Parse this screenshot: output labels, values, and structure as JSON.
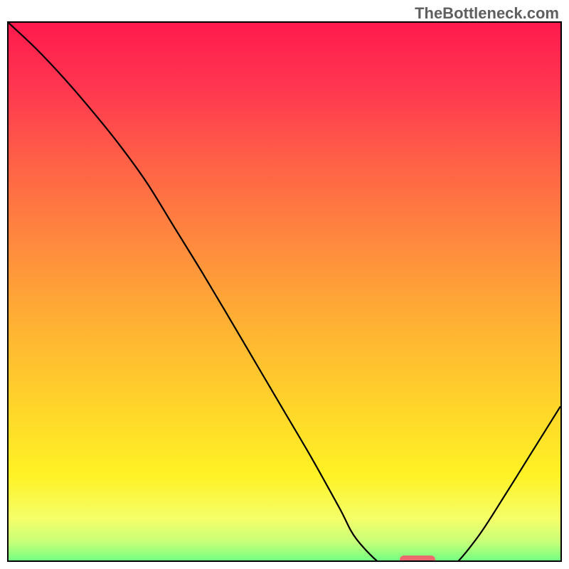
{
  "watermark": "TheBottleneck.com",
  "chart_data": {
    "type": "line",
    "title": "",
    "xlabel": "",
    "ylabel": "",
    "xlim": [
      0,
      100
    ],
    "ylim": [
      0,
      100
    ],
    "curve_x": [
      0,
      5,
      10,
      15,
      20,
      25,
      30,
      35,
      40,
      45,
      50,
      55,
      60,
      63,
      68,
      72,
      76,
      80,
      85,
      90,
      95,
      100
    ],
    "values": [
      100,
      95.3,
      90,
      84.2,
      78,
      71.1,
      63,
      54.9,
      46.5,
      38,
      29.5,
      21,
      12,
      6.5,
      1.5,
      0.3,
      0.3,
      1.1,
      6.8,
      14.5,
      22.5,
      30.5
    ],
    "marker": {
      "x": 74,
      "y": 0.3
    },
    "gradient_stops": [
      {
        "pct": 0,
        "color": "#ff1a4d"
      },
      {
        "pct": 12,
        "color": "#ff3750"
      },
      {
        "pct": 25,
        "color": "#ff6047"
      },
      {
        "pct": 40,
        "color": "#ff8a3e"
      },
      {
        "pct": 55,
        "color": "#ffb233"
      },
      {
        "pct": 70,
        "color": "#ffd62a"
      },
      {
        "pct": 82,
        "color": "#fff225"
      },
      {
        "pct": 90,
        "color": "#f4ff6a"
      },
      {
        "pct": 94,
        "color": "#c8ff78"
      },
      {
        "pct": 97,
        "color": "#80ff80"
      },
      {
        "pct": 100,
        "color": "#00e676"
      }
    ]
  }
}
